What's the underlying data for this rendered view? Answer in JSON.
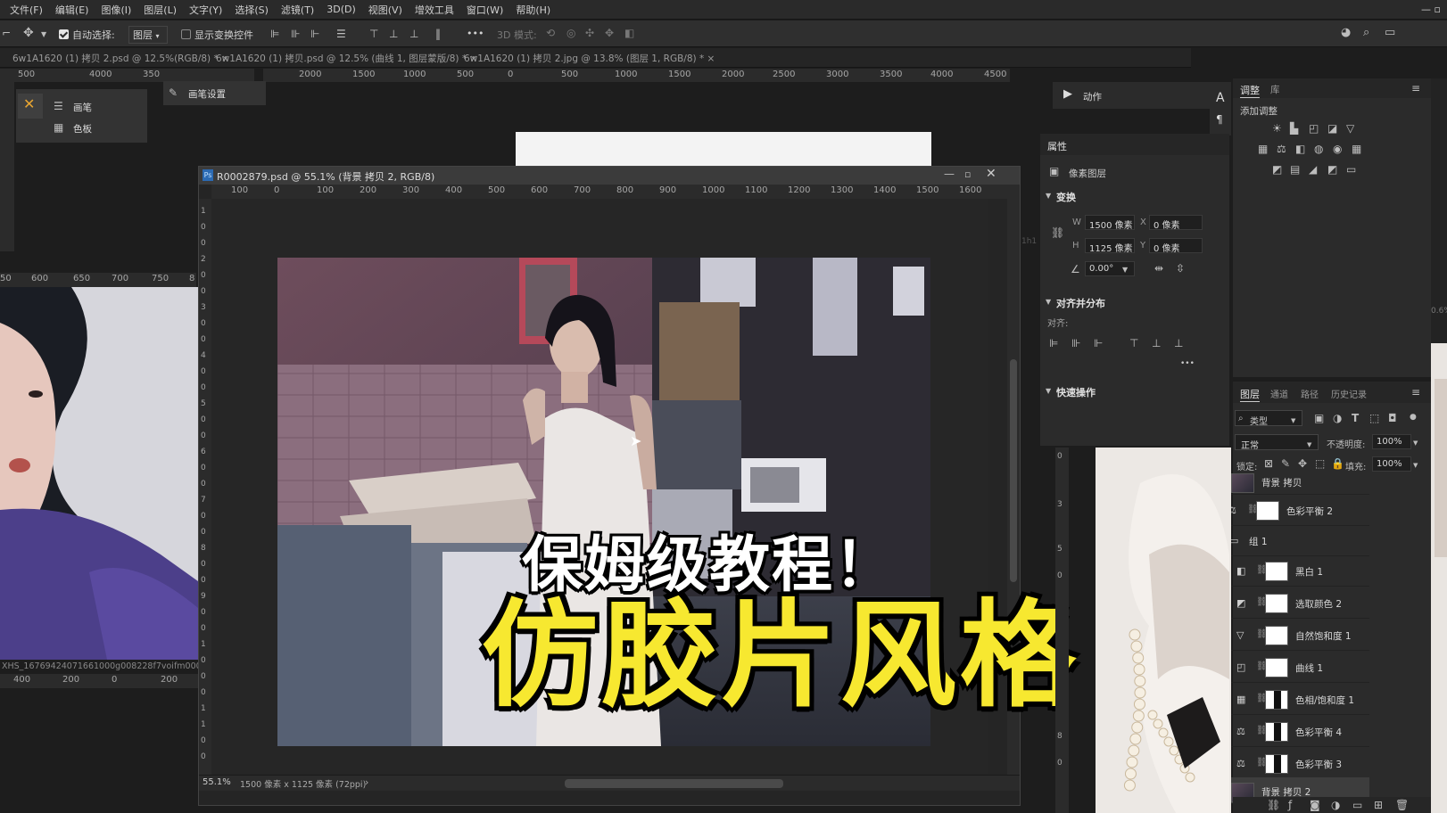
{
  "menu": [
    "文件(F)",
    "编辑(E)",
    "图像(I)",
    "图层(L)",
    "文字(Y)",
    "选择(S)",
    "滤镜(T)",
    "3D(D)",
    "视图(V)",
    "增效工具",
    "窗口(W)",
    "帮助(H)"
  ],
  "options": {
    "auto_select_label": "自动选择:",
    "auto_select_target": "图层",
    "show_transform_label": "显示变换控件",
    "more": "•••",
    "mode_3d": "3D 模式:"
  },
  "doc_tabs": [
    "6w1A1620 (1) 拷贝 2.psd @ 12.5%(RGB/8) *",
    "6w1A1620 (1) 拷贝.psd @ 12.5% (曲线 1, 图层蒙版/8) *",
    "6w1A1620 (1) 拷贝 2.jpg @ 13.8% (图层 1, RGB/8) *"
  ],
  "tab_close": "×",
  "top_ruler_labels": [
    "2000",
    "1500",
    "1000",
    "500",
    "0",
    "500",
    "1000",
    "1500",
    "2000",
    "2500",
    "3000",
    "3500",
    "4000",
    "4500"
  ],
  "bg_ruler_left_top": [
    "500",
    "4000",
    "350"
  ],
  "bg_ruler_left": [
    "50",
    "600",
    "650",
    "700",
    "750",
    "8"
  ],
  "bg_ruler_left_bottom": [
    "400",
    "200",
    "0",
    "200"
  ],
  "bg_vruler_right": [
    "0",
    "3",
    "5",
    "0",
    "8",
    "0"
  ],
  "left_filename": "XHS_1676942407166100​0g008228f7voifm000",
  "left_filename_vis": "XHS_1676942407166100​0g008228f7voifm000'",
  "mini_panel": {
    "brush_label": "画笔",
    "swatches_label": "色板",
    "brush_settings_label": "画笔设置"
  },
  "window": {
    "title": "R0002879.psd @ 55.1% (背景 拷贝 2, RGB/8)",
    "ruler_labels": [
      "100",
      "0",
      "100",
      "200",
      "300",
      "400",
      "500",
      "600",
      "700",
      "800",
      "900",
      "1000",
      "1100",
      "1200",
      "1300",
      "1400",
      "1500",
      "1600"
    ],
    "vruler_labels": [
      "1",
      "0",
      "0",
      "2",
      "0",
      "0",
      "3",
      "0",
      "0",
      "4",
      "0",
      "0",
      "5",
      "0",
      "0",
      "6",
      "0",
      "0",
      "7",
      "0",
      "0",
      "8",
      "0",
      "0",
      "9",
      "0",
      "0",
      "1",
      "0",
      "0",
      "0",
      "1",
      "1",
      "0",
      "0"
    ],
    "status_zoom": "55.1%",
    "status_size": "1500 像素 x 1125 像素 (72ppi)",
    "status_arrow": "›"
  },
  "overlay": {
    "line1": "保姆级教程！",
    "line2": "仿胶片风格"
  },
  "actions_panel": {
    "label": "动作"
  },
  "properties": {
    "tab": "属性",
    "layer_type": "像素图层",
    "transform_title": "变换",
    "w_label": "W",
    "w_value": "1500 像素",
    "h_label": "H",
    "h_value": "1125 像素",
    "x_label": "X",
    "x_value": "0 像素",
    "y_label": "Y",
    "y_value": "0 像素",
    "angle_value": "0.00°",
    "align_title": "对齐并分布",
    "align_label": "对齐:",
    "more": "•••",
    "quick_title": "快速操作",
    "side_text": "1h1"
  },
  "adjustments": {
    "tab_active": "调整",
    "tab_other": "库",
    "add_label": "添加调整"
  },
  "layers_panel": {
    "tabs": [
      "图层",
      "通道",
      "路径",
      "历史记录"
    ],
    "filter_kind": "类型",
    "blend_mode": "正常",
    "opacity_label": "不透明度:",
    "opacity_value": "100%",
    "lock_label": "锁定:",
    "fill_label": "填充:",
    "fill_value": "100%",
    "layers": [
      {
        "name": "背景 拷贝",
        "visible": false,
        "kind": "photo",
        "icon": ""
      },
      {
        "name": "色彩平衡 2",
        "visible": false,
        "kind": "adj",
        "icon": "⚖"
      },
      {
        "name": "组 1",
        "visible": true,
        "kind": "group",
        "icon": "📁"
      },
      {
        "name": "黑白 1",
        "visible": true,
        "kind": "adj",
        "icon": "◧"
      },
      {
        "name": "选取颜色 2",
        "visible": true,
        "kind": "adj",
        "icon": "◩"
      },
      {
        "name": "自然饱和度 1",
        "visible": true,
        "kind": "adj",
        "icon": "▽"
      },
      {
        "name": "曲线 1",
        "visible": true,
        "kind": "adj",
        "icon": "◰"
      },
      {
        "name": "色相/饱和度 1",
        "visible": true,
        "kind": "mask",
        "icon": "▦"
      },
      {
        "name": "色彩平衡 4",
        "visible": true,
        "kind": "mask",
        "icon": "⚖"
      },
      {
        "name": "色彩平衡 3",
        "visible": true,
        "kind": "mask",
        "icon": "⚖"
      },
      {
        "name": "背景 拷贝 2",
        "visible": true,
        "kind": "photo",
        "icon": ""
      }
    ]
  },
  "right_edge": {
    "pct": "0.6%"
  },
  "colors": {
    "accent_yellow": "#f7e830",
    "panel_bg": "#2b2b2b",
    "app_bg": "#1d1d1d"
  }
}
